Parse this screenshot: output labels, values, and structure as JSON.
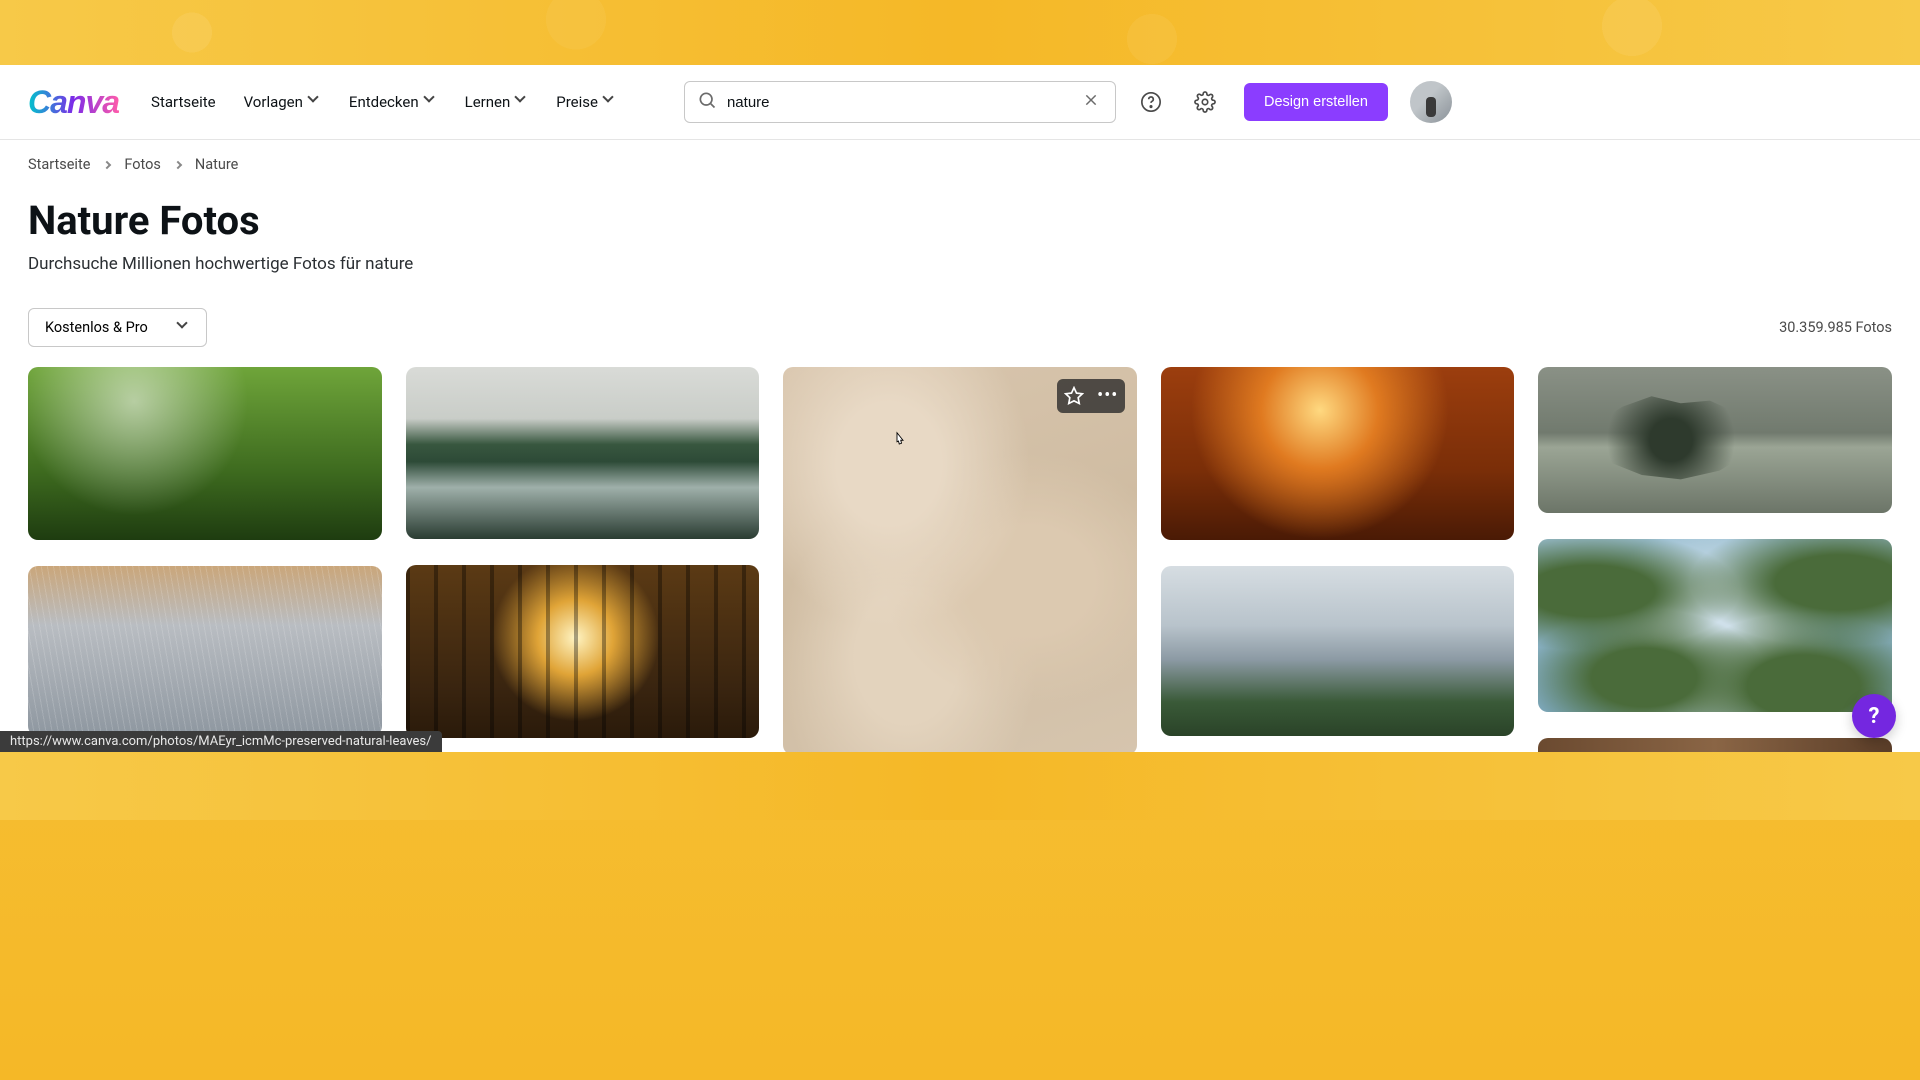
{
  "nav": {
    "home": "Startseite",
    "templates": "Vorlagen",
    "discover": "Entdecken",
    "learn": "Lernen",
    "pricing": "Preise"
  },
  "search": {
    "value": "nature"
  },
  "cta": "Design erstellen",
  "breadcrumb": {
    "home": "Startseite",
    "photos": "Fotos",
    "current": "Nature"
  },
  "page": {
    "title": "Nature Fotos",
    "subtitle": "Durchsuche Millionen hochwertige Fotos für nature"
  },
  "filter": {
    "label": "Kostenlos & Pro"
  },
  "results": {
    "count_text": "30.359.985 Fotos"
  },
  "status_url": "https://www.canva.com/photos/MAEyr_icmMc-preserved-natural-leaves/",
  "help_fab": "?"
}
